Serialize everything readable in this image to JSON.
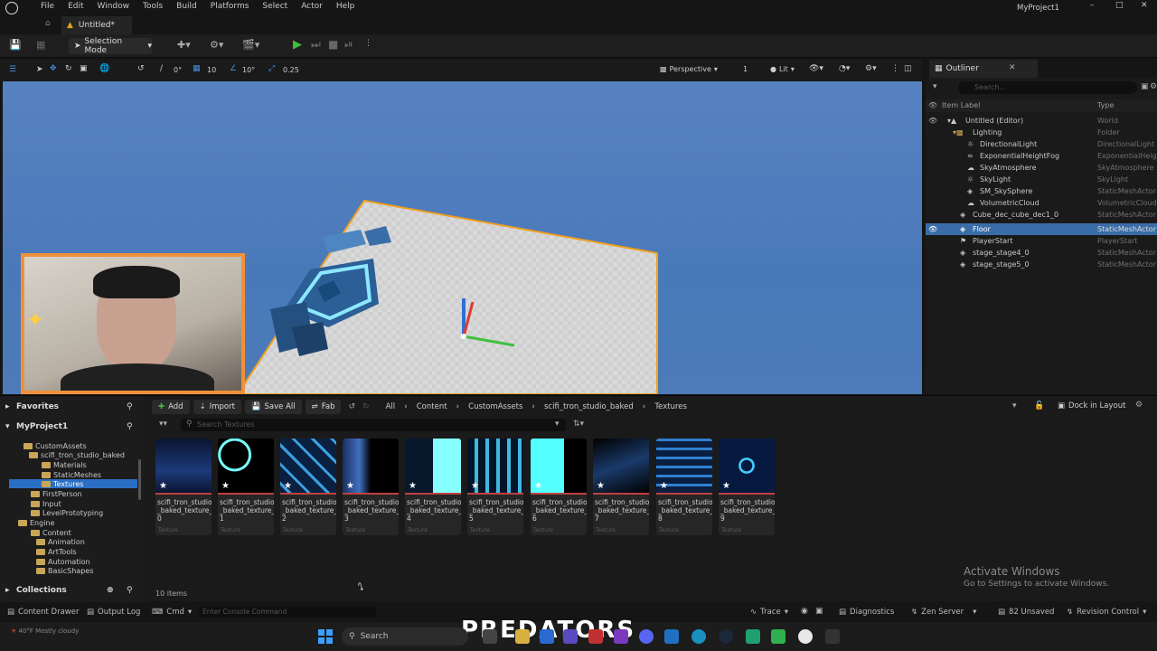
{
  "menubar": {
    "items": [
      "File",
      "Edit",
      "Window",
      "Tools",
      "Build",
      "Platforms",
      "Select",
      "Actor",
      "Help"
    ],
    "project_name": "MyProject1"
  },
  "tabs": {
    "document": "Untitled*"
  },
  "toolbar": {
    "selection_mode": "Selection Mode"
  },
  "viewport_toolbar": {
    "rotation_snap": "0°",
    "grid_snap": "10",
    "angle_snap": "10°",
    "scale_snap": "0.25",
    "view_mode": "Perspective",
    "lighting_mode": "Lit",
    "camera_speed": "1"
  },
  "outliner": {
    "tab_title": "Outliner",
    "search_placeholder": "Search...",
    "col_label": "Item Label",
    "col_type": "Type",
    "rows": [
      {
        "label": "Untitled (Editor)",
        "type": "World"
      },
      {
        "label": "Lighting",
        "type": "Folder"
      },
      {
        "label": "DirectionalLight",
        "type": "DirectionalLight"
      },
      {
        "label": "ExponentialHeightFog",
        "type": "ExponentialHeigh"
      },
      {
        "label": "SkyAtmosphere",
        "type": "SkyAtmosphere"
      },
      {
        "label": "SkyLight",
        "type": "SkyLight"
      },
      {
        "label": "SM_SkySphere",
        "type": "StaticMeshActor"
      },
      {
        "label": "VolumetricCloud",
        "type": "VolumetricCloud"
      },
      {
        "label": "Cube_dec_cube_dec1_0",
        "type": "StaticMeshActor"
      },
      {
        "label": "Floor",
        "type": "StaticMeshActor"
      },
      {
        "label": "PlayerStart",
        "type": "PlayerStart"
      },
      {
        "label": "stage_stage4_0",
        "type": "StaticMeshActor"
      },
      {
        "label": "stage_stage5_0",
        "type": "StaticMeshActor"
      }
    ]
  },
  "sources": {
    "favorites": "Favorites",
    "project": "MyProject1",
    "collections": "Collections",
    "folders": [
      "CustomAssets",
      "scifi_tron_studio_baked",
      "Materials",
      "StaticMeshes",
      "Textures",
      "FirstPerson",
      "Input",
      "LevelPrototyping",
      "Engine",
      "Content",
      "Animation",
      "ArtTools",
      "Automation",
      "BasicShapes"
    ]
  },
  "content_browser": {
    "add": "Add",
    "import": "Import",
    "save_all": "Save All",
    "fab": "Fab",
    "breadcrumb": [
      "All",
      "Content",
      "CustomAssets",
      "scifi_tron_studio_baked",
      "Textures"
    ],
    "dock": "Dock in Layout",
    "search_placeholder": "Search Textures",
    "items_count": "10 items",
    "assets": [
      {
        "name": "scifi_tron_studio\n_baked_texture_\n0",
        "type": "Texture"
      },
      {
        "name": "scifi_tron_studio\n_baked_texture_\n1",
        "type": "Texture"
      },
      {
        "name": "scifi_tron_studio\n_baked_texture_\n2",
        "type": "Texture"
      },
      {
        "name": "scifi_tron_studio\n_baked_texture_\n3",
        "type": "Texture"
      },
      {
        "name": "scifi_tron_studio\n_baked_texture_\n4",
        "type": "Texture"
      },
      {
        "name": "scifi_tron_studio\n_baked_texture_\n5",
        "type": "Texture"
      },
      {
        "name": "scifi_tron_studio\n_baked_texture_\n6",
        "type": "Texture"
      },
      {
        "name": "scifi_tron_studio\n_baked_texture_\n7",
        "type": "Texture"
      },
      {
        "name": "scifi_tron_studio\n_baked_texture_\n8",
        "type": "Texture"
      },
      {
        "name": "scifi_tron_studio\n_baked_texture_\n9",
        "type": "Texture"
      }
    ]
  },
  "watermark": {
    "line1": "Activate Windows",
    "line2": "Go to Settings to activate Windows."
  },
  "statusbar": {
    "content_drawer": "Content Drawer",
    "output_log": "Output Log",
    "cmd": "Cmd",
    "console_placeholder": "Enter Console Command",
    "trace": "Trace",
    "diagnostics": "Diagnostics",
    "zen_server": "Zen Server",
    "unsaved": "82 Unsaved",
    "revision_control": "Revision Control"
  },
  "taskbar": {
    "search_placeholder": "Search",
    "banner": "PREDATORS",
    "weather": "40°F Mostly cloudy"
  },
  "colors": {
    "accent": "#2b6fc4",
    "selection_row": "#3a6da8",
    "sky": "#4a79ba"
  }
}
